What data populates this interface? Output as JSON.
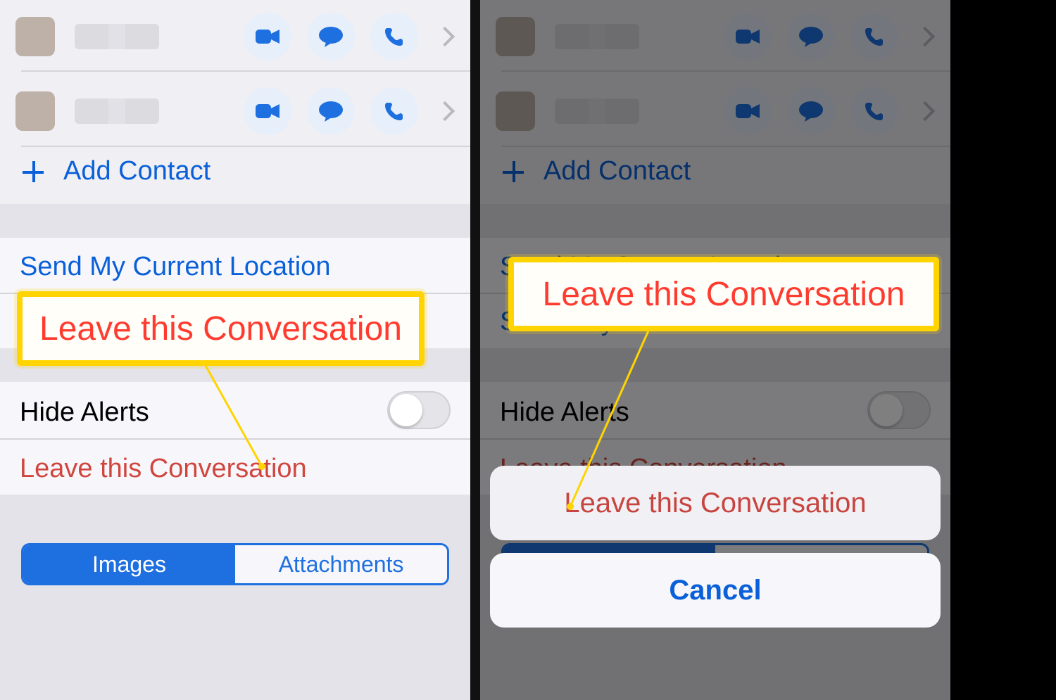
{
  "contacts": {
    "addContact": "Add Contact"
  },
  "rows": {
    "sendLocation": "Send My Current Location",
    "shareLocation": "Share My Location",
    "hideAlerts": "Hide Alerts",
    "leave": "Leave this Conversation"
  },
  "segmented": {
    "images": "Images",
    "attachments": "Attachments"
  },
  "sheet": {
    "leave": "Leave this Conversation",
    "cancel": "Cancel"
  },
  "callout": {
    "leaveL": "Leave this Conversation",
    "leaveR": "Leave this Conversation"
  }
}
